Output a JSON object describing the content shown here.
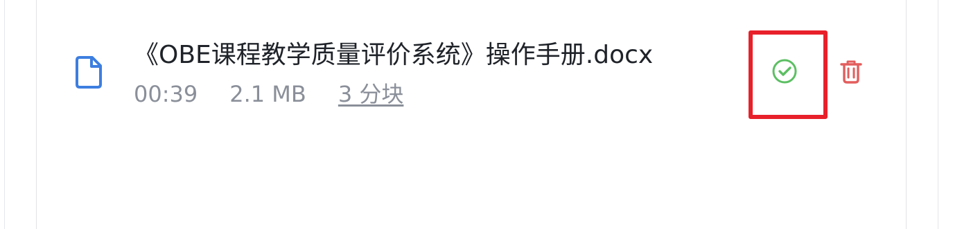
{
  "file": {
    "name": "《OBE课程教学质量评价系统》操作手册.docx",
    "duration": "00:39",
    "size": "2.1 MB",
    "chunks": "3 分块",
    "status": "completed",
    "icons": {
      "file": "document-icon",
      "status": "check-circle-icon",
      "delete": "trash-icon"
    }
  },
  "colors": {
    "file_icon": "#3d7ee0",
    "status_ok": "#5cbf63",
    "delete": "#e35d5d",
    "highlight": "#e8202a",
    "title_text": "#1f2329",
    "meta_text": "#8a8f99"
  }
}
